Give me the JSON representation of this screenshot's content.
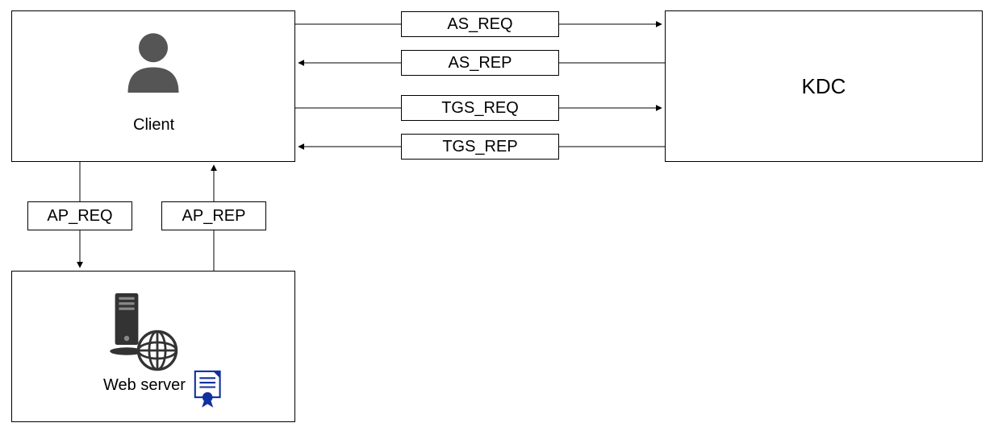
{
  "nodes": {
    "client": {
      "label": "Client"
    },
    "kdc": {
      "label": "KDC"
    },
    "web": {
      "label": "Web server"
    }
  },
  "messages": {
    "as_req": {
      "label": "AS_REQ"
    },
    "as_rep": {
      "label": "AS_REP"
    },
    "tgs_req": {
      "label": "TGS_REQ"
    },
    "tgs_rep": {
      "label": "TGS_REP"
    },
    "ap_req": {
      "label": "AP_REQ"
    },
    "ap_rep": {
      "label": "AP_REP"
    }
  }
}
